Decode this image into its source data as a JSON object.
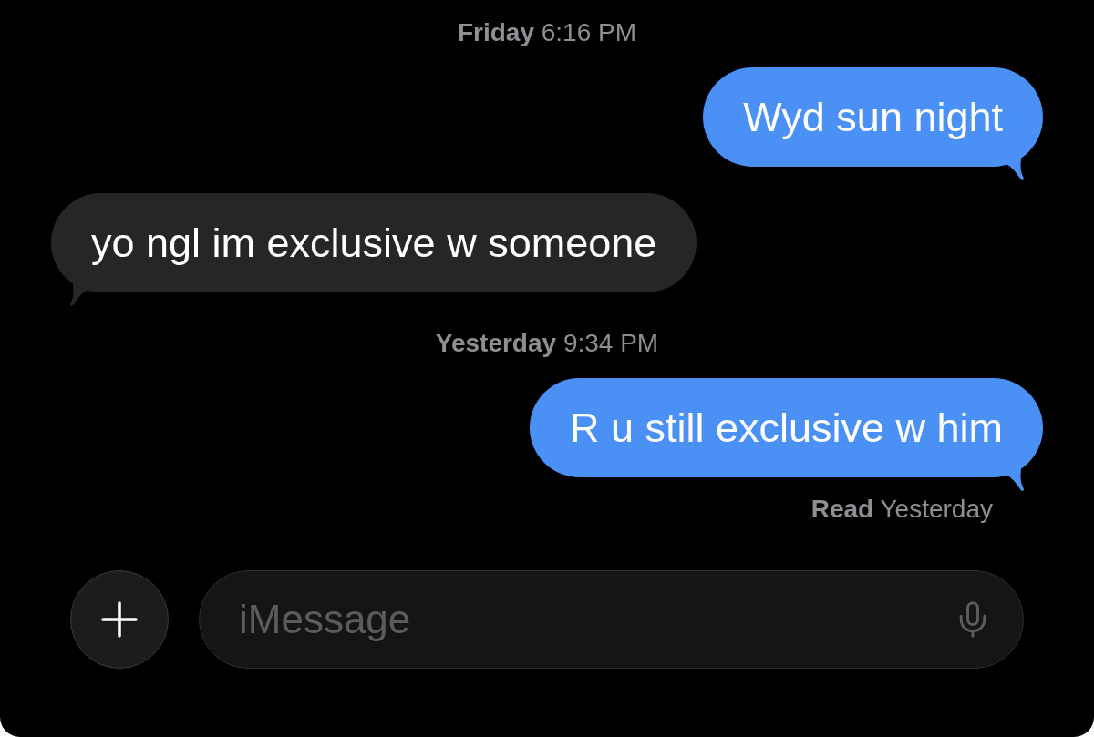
{
  "conversation": [
    {
      "kind": "timestamp",
      "text": "**Friday** 6:16 PM"
    },
    {
      "kind": "sent",
      "text": "Wyd sun night"
    },
    {
      "kind": "received",
      "text": "yo ngl im exclusive w someone"
    },
    {
      "kind": "timestamp",
      "text": "**Yesterday** 9:34 PM"
    },
    {
      "kind": "sent",
      "text": "R u still exclusive w him"
    },
    {
      "kind": "receipt",
      "text": "**Read** Yesterday"
    }
  ],
  "composer": {
    "placeholder": "iMessage"
  }
}
